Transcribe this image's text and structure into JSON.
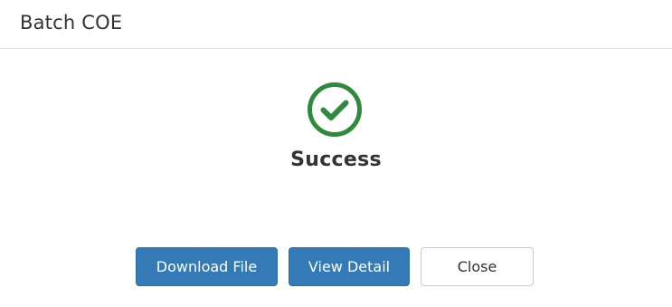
{
  "dialog": {
    "title": "Batch COE"
  },
  "status": {
    "icon": "check-circle-icon",
    "icon_color": "#2e8b3e",
    "text": "Success"
  },
  "actions": {
    "download_label": "Download File",
    "view_label": "View Detail",
    "close_label": "Close",
    "primary_color": "#337ab7"
  }
}
